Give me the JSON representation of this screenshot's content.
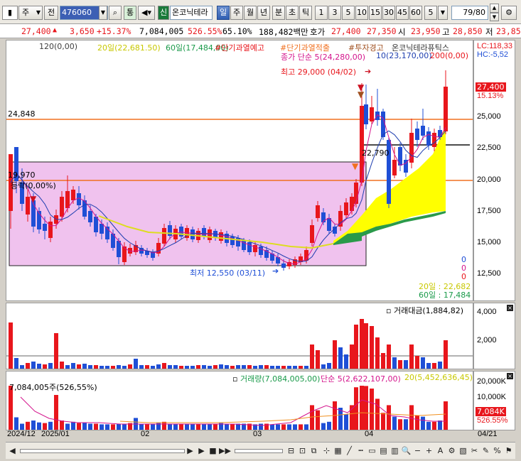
{
  "toolbar": {
    "btn_ju": "주",
    "btn_jeon": "전",
    "code": "476060",
    "btn_tong": "통",
    "btn_sin": "신",
    "name": "온코닉테라",
    "periods": [
      "일",
      "주",
      "월",
      "년",
      "분",
      "초",
      "틱"
    ],
    "active_period": "일",
    "intervals": [
      "1",
      "3",
      "5",
      "10",
      "15",
      "30",
      "45",
      "60",
      "5"
    ],
    "count": "79/80"
  },
  "quote": {
    "price": "27,400",
    "change": "3,650",
    "rate": "+15.37%",
    "volume": "7,084,005",
    "vol_rate": "526.55%",
    "turnover": "65.10%",
    "amount": "188,482백만",
    "ask_label": "호가",
    "ask": "27,400",
    "bid": "27,350",
    "open_label": "시",
    "open": "23,950",
    "high_label": "고",
    "high": "28,850",
    "low_label": "저",
    "low": "23,85"
  },
  "price_panel": {
    "legend_ma120": "120(0,00)",
    "legend_ma20": "20일(22,681.50)",
    "legend_ma60": "60일(17,484,00)",
    "legend_warn1": "#단기과열예고",
    "legend_warn2": "#단기과열적출",
    "legend_warn3": "#투자경고",
    "legend_name": "온코닉테라퓨틱스",
    "legend_close": "종가 단순 5(24,280,00)",
    "legend_ma10": "10(23,170,00)",
    "legend_ma200": "200(0,00)",
    "lc": "LC:118,33",
    "hc": "HC:-5,52",
    "hline_24848": "24,848",
    "hline_22790": "22,790",
    "box_label": "19,970",
    "box_pct": "등락(0,00%)",
    "high_note": "최고 29,000 (04/02)",
    "low_note": "최저 12,550 (03/11)",
    "zero1": "0",
    "zero2": "0",
    "zero3": "0",
    "ma20_val": "20일 : 22,682",
    "ma60_val": "60일 : 17,484",
    "axis_ticks": [
      "25,000",
      "22,500",
      "20,000",
      "17,500",
      "15,000",
      "12,500"
    ],
    "cur_price": "27,400",
    "cur_rate": "15.13%"
  },
  "amount_panel": {
    "legend": "거래대금(1,884,82)",
    "axis_ticks": [
      "4,000",
      "2,000"
    ]
  },
  "volume_panel": {
    "legend_vol": "거래량(7,084,005,00)",
    "legend_ma5": "단순 5(2,622,107,00)",
    "legend_ma20": "20(5,452,636,45)",
    "vol_label": "7,084,005주(526,55%)",
    "axis_ticks": [
      "20,000K",
      "10,000K"
    ],
    "cur_vol": "7,084K",
    "cur_rate": "526.55%"
  },
  "xaxis": {
    "labels": [
      "2024/12",
      "2025/01",
      "02",
      "03",
      "04",
      "04/21"
    ]
  },
  "colors": {
    "up": "#e8161c",
    "down": "#1f4fd6",
    "ma20": "#e6e600",
    "ma60": "#1a9a4a",
    "box": "#f0c2ee",
    "orange": "#f07020"
  }
}
